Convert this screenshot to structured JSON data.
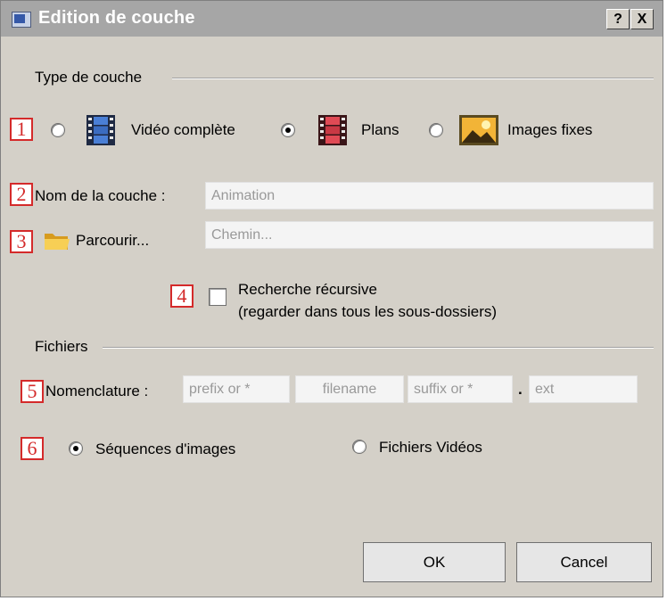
{
  "window": {
    "title": "Edition de couche",
    "help_label": "?",
    "close_label": "X"
  },
  "type_section": {
    "label": "Type de couche",
    "options": [
      {
        "label": "Vidéo complète",
        "icon": "film-strip-blue-icon",
        "checked": false
      },
      {
        "label": "Plans",
        "icon": "film-strip-red-icon",
        "checked": true
      },
      {
        "label": "Images fixes",
        "icon": "landscape-image-icon",
        "checked": false
      }
    ]
  },
  "layer_name": {
    "label": "Nom de la couche :",
    "placeholder": "Animation"
  },
  "browse": {
    "label": "Parcourir...",
    "icon": "folder-icon",
    "placeholder": "Chemin..."
  },
  "recursive": {
    "line1": "Recherche récursive",
    "line2": "(regarder dans tous les sous-dossiers)",
    "checked": false
  },
  "files_section": {
    "label": "Fichiers",
    "nomenclature": {
      "label": "Nomenclature :",
      "prefix_placeholder": "prefix or *",
      "filename_placeholder": "filename",
      "suffix_placeholder": "suffix or *",
      "dot": ".",
      "ext_placeholder": "ext"
    },
    "modes": [
      {
        "label": "Séquences d'images",
        "checked": true
      },
      {
        "label": "Fichiers Vidéos",
        "checked": false
      }
    ]
  },
  "buttons": {
    "ok": "OK",
    "cancel": "Cancel"
  },
  "annotations": [
    "1",
    "2",
    "3",
    "4",
    "5",
    "6"
  ],
  "colors": {
    "marker": "#d42a2a",
    "dialog_bg": "#d4d0c8",
    "titlebar": "#a6a6a6"
  }
}
